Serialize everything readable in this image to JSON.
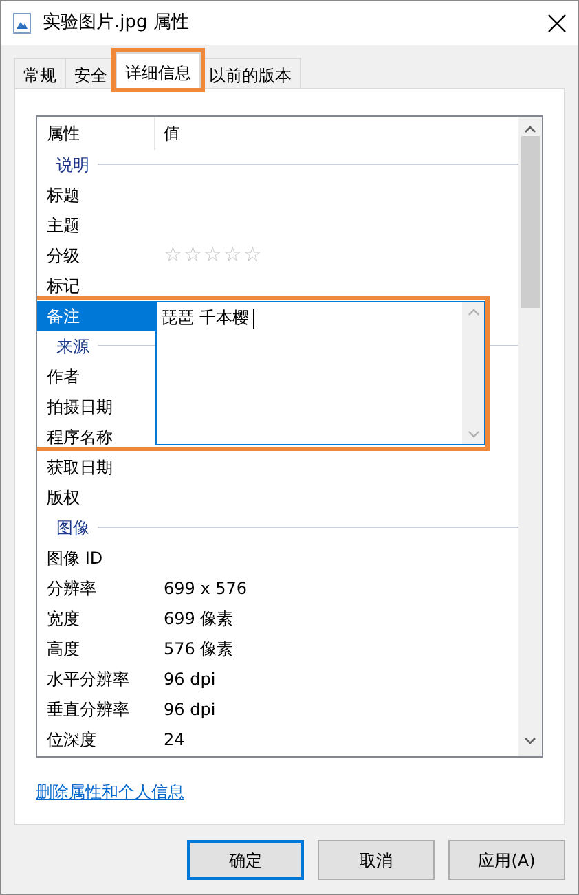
{
  "window": {
    "title": "实验图片.jpg 属性"
  },
  "tabs": [
    {
      "label": "常规",
      "selected": false,
      "highlighted": false
    },
    {
      "label": "安全",
      "selected": false,
      "highlighted": false
    },
    {
      "label": "详细信息",
      "selected": true,
      "highlighted": true
    },
    {
      "label": "以前的版本",
      "selected": false,
      "highlighted": false
    }
  ],
  "details": {
    "columns": [
      "属性",
      "值"
    ],
    "rows": [
      {
        "kind": "group",
        "label": "说明"
      },
      {
        "kind": "property",
        "label": "标题",
        "selected": false
      },
      {
        "kind": "property",
        "label": "主题",
        "selected": false
      },
      {
        "kind": "rating",
        "label": "分级",
        "selected": false,
        "stars": 0
      },
      {
        "kind": "property",
        "label": "标记",
        "selected": false
      },
      {
        "kind": "property",
        "label": "备注",
        "selected": true,
        "editor": {
          "value": "琵琶 千本樱",
          "highlighted": true
        }
      },
      {
        "kind": "group",
        "label": "来源"
      },
      {
        "kind": "property",
        "label": "作者",
        "selected": false
      },
      {
        "kind": "property",
        "label": "拍摄日期",
        "selected": false
      },
      {
        "kind": "property",
        "label": "程序名称",
        "selected": false
      },
      {
        "kind": "property",
        "label": "获取日期",
        "selected": false
      },
      {
        "kind": "property",
        "label": "版权",
        "selected": false
      },
      {
        "kind": "group",
        "label": "图像"
      },
      {
        "kind": "property",
        "label": "图像 ID",
        "selected": false
      },
      {
        "kind": "property",
        "label": "分辨率",
        "value": "699 x 576",
        "selected": false
      },
      {
        "kind": "property",
        "label": "宽度",
        "value": "699 像素",
        "selected": false
      },
      {
        "kind": "property",
        "label": "高度",
        "value": "576 像素",
        "selected": false
      },
      {
        "kind": "property",
        "label": "水平分辨率",
        "value": "96 dpi",
        "selected": false
      },
      {
        "kind": "property",
        "label": "垂直分辨率",
        "value": "96 dpi",
        "selected": false
      },
      {
        "kind": "property",
        "label": "位深度",
        "value": "24",
        "selected": false
      }
    ]
  },
  "link": "删除属性和个人信息",
  "buttons": [
    {
      "label": "确定",
      "default": true
    },
    {
      "label": "取消",
      "default": false
    },
    {
      "label": "应用(A)",
      "default": false
    }
  ]
}
